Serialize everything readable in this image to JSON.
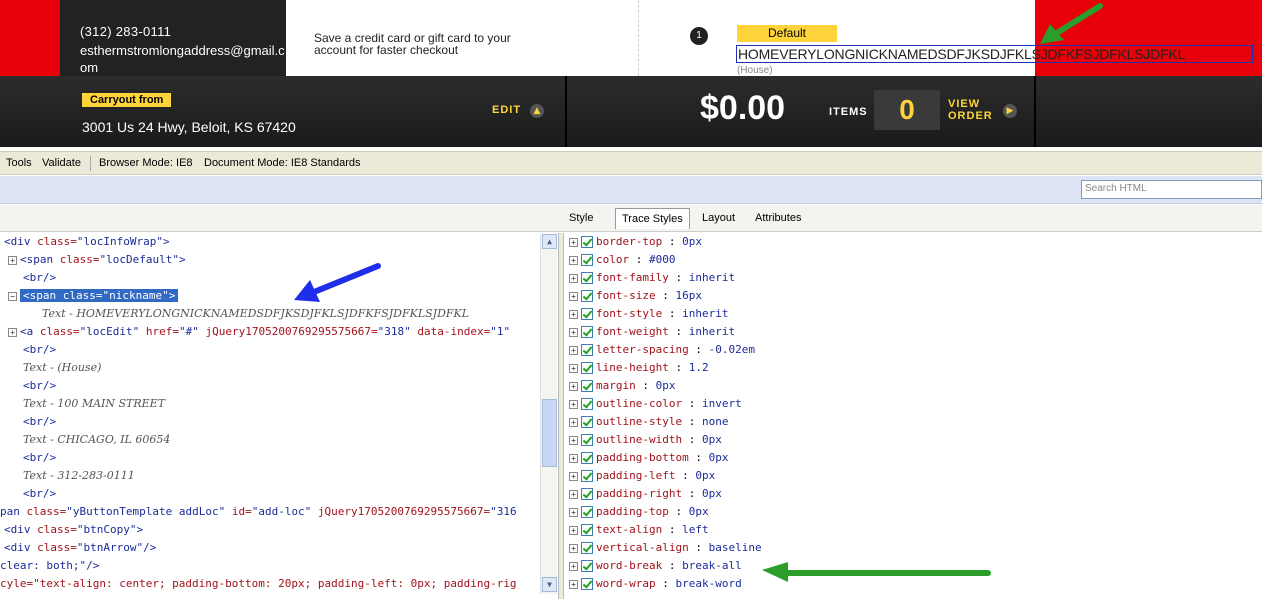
{
  "site": {
    "user_phone": "(312) 283-0111",
    "user_email": "esthermstromlongaddress@gmail.com",
    "payment_text": "Save a credit card or gift card to your account for faster checkout",
    "location_number": "1",
    "location_default_label": "Default",
    "location_nickname": "HOMEVERYLONGNICKNAMEDSDFJKSDJFKLSJDFKFSJDFKLSJDFKL",
    "location_type": "(House)",
    "carryout_label": "Carryout from",
    "carryout_address": "3001 Us 24 Hwy, Beloit, KS 67420",
    "edit_label": "EDIT",
    "order_total": "$0.00",
    "items_label": "ITEMS",
    "items_count": "0",
    "view_order_label_1": "VIEW",
    "view_order_label_2": "ORDER",
    "colors": {
      "brand_red": "#e8000a",
      "accent_yellow": "#ffd43a"
    }
  },
  "devtools": {
    "menu": {
      "tools": "Tools",
      "validate": "Validate",
      "browser_mode": "Browser Mode:  IE8",
      "document_mode": "Document Mode:  IE8 Standards"
    },
    "search_placeholder": "Search HTML",
    "tabs": {
      "style": "Style",
      "trace_styles": "Trace Styles",
      "layout": "Layout",
      "attributes": "Attributes"
    },
    "html_tree": {
      "l1_tag": "<div ",
      "l1_attr": "class=",
      "l1_val": "\"locInfoWrap\"",
      "l1_end": ">",
      "l2_tag": "<span ",
      "l2_attr": "class=",
      "l2_val": "\"locDefault\"",
      "l2_end": ">",
      "br": "<br/>",
      "l4_tag": "<span ",
      "l4_attr": "class=",
      "l4_val": "\"nickname\"",
      "l4_end": ">",
      "l5_text": "Text - HOMEVERYLONGNICKNAMEDSDFJKSDJFKLSJDFKFSJDFKLSJDFKL",
      "l6_tag": "<a ",
      "l6_attr1": "class=",
      "l6_val1": "\"locEdit\"",
      "l6_attr2": " href=",
      "l6_val2": "\"#\"",
      "l6_attr3": " jQuery1705200769295575667=",
      "l6_val3": "\"318\"",
      "l6_attr4": " data-index=",
      "l6_val4": "\"1\"",
      "text_house": "Text - (House)",
      "text_street": "Text - 100 MAIN STREET",
      "text_city": "Text - CHICAGO, IL 60654",
      "text_phone": "Text - 312-283-0111",
      "l16_tag": "pan ",
      "l16_attr1": "class=",
      "l16_val1": "\"yButtonTemplate addLoc\"",
      "l16_attr2": " id=",
      "l16_val2": "\"add-loc\"",
      "l16_attr3": " jQuery1705200769295575667=",
      "l16_val3": "\"316",
      "l17_tag": "<div ",
      "l17_attr": "class=",
      "l17_val": "\"btnCopy\"",
      "l17_end": ">",
      "l18_tag": "<div ",
      "l18_attr": "class=",
      "l18_val": "\"btnArrow\"",
      "l18_end": "/>",
      "l19_text": "clear: both;\"/>",
      "l20_text": "cyle=\"text-align: center; padding-bottom: 20px; padding-left: 0px; padding-rig"
    },
    "styles": [
      {
        "prop": "border-top",
        "value": "0px"
      },
      {
        "prop": "color",
        "value": "#000"
      },
      {
        "prop": "font-family",
        "value": "inherit"
      },
      {
        "prop": "font-size",
        "value": "16px"
      },
      {
        "prop": "font-style",
        "value": "inherit"
      },
      {
        "prop": "font-weight",
        "value": "inherit"
      },
      {
        "prop": "letter-spacing",
        "value": "-0.02em"
      },
      {
        "prop": "line-height",
        "value": "1.2"
      },
      {
        "prop": "margin",
        "value": "0px"
      },
      {
        "prop": "outline-color",
        "value": "invert"
      },
      {
        "prop": "outline-style",
        "value": "none"
      },
      {
        "prop": "outline-width",
        "value": "0px"
      },
      {
        "prop": "padding-bottom",
        "value": "0px"
      },
      {
        "prop": "padding-left",
        "value": "0px"
      },
      {
        "prop": "padding-right",
        "value": "0px"
      },
      {
        "prop": "padding-top",
        "value": "0px"
      },
      {
        "prop": "text-align",
        "value": "left"
      },
      {
        "prop": "vertical-align",
        "value": "baseline"
      },
      {
        "prop": "word-break",
        "value": "break-all"
      },
      {
        "prop": "word-wrap",
        "value": "break-word"
      }
    ]
  }
}
